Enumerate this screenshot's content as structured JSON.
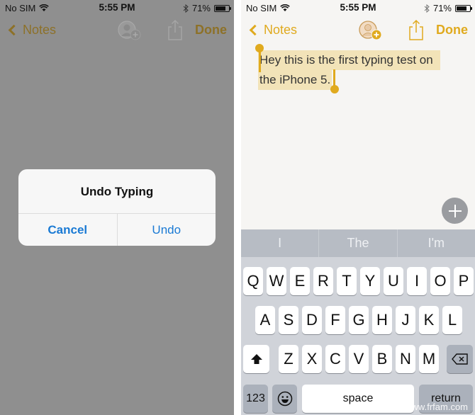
{
  "status_bar": {
    "carrier": "No SIM",
    "time": "5:55 PM",
    "battery_percent_label": "71%",
    "battery_level": 0.71,
    "icons": [
      "wifi-icon",
      "bluetooth-icon",
      "battery-icon"
    ]
  },
  "nav": {
    "back_label": "Notes",
    "done_label": "Done",
    "icons": [
      "chevron-left-icon",
      "add-person-icon",
      "share-icon"
    ]
  },
  "left_screen": {
    "alert": {
      "title": "Undo Typing",
      "cancel_label": "Cancel",
      "undo_label": "Undo"
    }
  },
  "right_screen": {
    "note": {
      "line1": "Hey this is the first typing test on",
      "line2": "the iPhone 5.",
      "selected": true
    },
    "add_button_icon": "plus-icon",
    "predictions": [
      "I",
      "The",
      "I'm"
    ],
    "keyboard": {
      "row1": [
        "Q",
        "W",
        "E",
        "R",
        "T",
        "Y",
        "U",
        "I",
        "O",
        "P"
      ],
      "row2": [
        "A",
        "S",
        "D",
        "F",
        "G",
        "H",
        "J",
        "K",
        "L"
      ],
      "row3": [
        "Z",
        "X",
        "C",
        "V",
        "B",
        "N",
        "M"
      ],
      "numbers_label": "123",
      "space_label": "space",
      "return_label": "return",
      "icons": [
        "shift-icon",
        "delete-icon",
        "emoji-icon"
      ]
    }
  },
  "watermark": "www.frfam.com",
  "colors": {
    "accent": "#e0aa1e",
    "alert_button": "#1a7ad4",
    "dim_overlay": "#8f8f8f",
    "keyboard_bg": "#d0d3d9",
    "prediction_bar": "#b7bcc4"
  }
}
